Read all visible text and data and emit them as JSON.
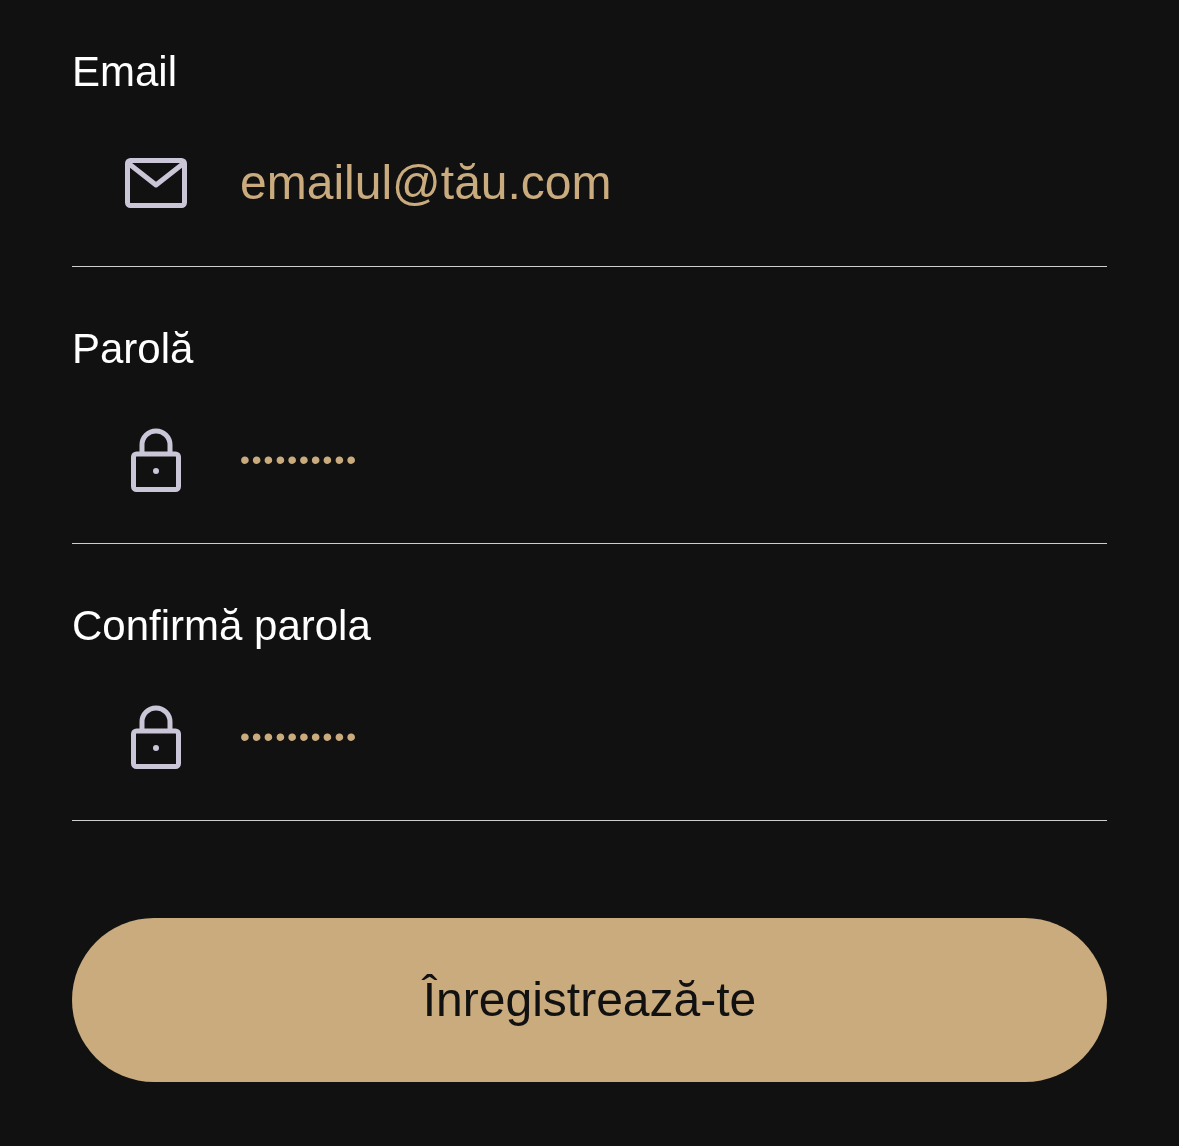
{
  "fields": [
    {
      "kind": "email",
      "label": "Email",
      "placeholder": "emailul@tău.com"
    },
    {
      "kind": "password",
      "label": "Parolă",
      "placeholder": "••••••••••"
    },
    {
      "kind": "password",
      "label": "Confirmă parola",
      "placeholder": "••••••••••"
    }
  ],
  "submit_button": "Înregistrează-te"
}
